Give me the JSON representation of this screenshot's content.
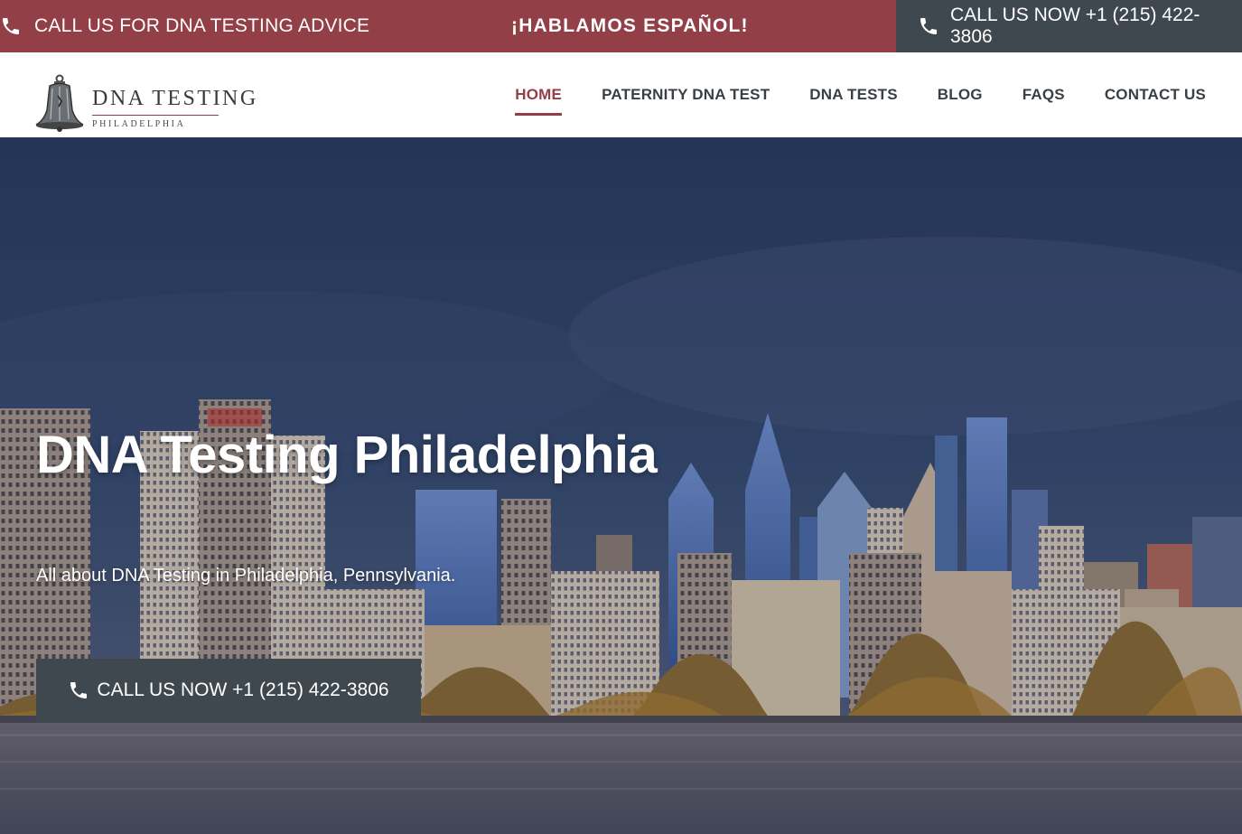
{
  "topbar": {
    "advice_label": "CALL US FOR DNA TESTING ADVICE",
    "spanish_label": "¡HABLAMOS ESPAÑOL!",
    "call_label": "CALL US NOW +1 (215) 422-3806"
  },
  "header": {
    "logo_title": "DNA TESTING",
    "logo_subtitle": "PHILADELPHIA",
    "nav": [
      {
        "label": "HOME",
        "active": true
      },
      {
        "label": "PATERNITY DNA TEST"
      },
      {
        "label": "DNA TESTS"
      },
      {
        "label": "BLOG"
      },
      {
        "label": "FAQS"
      },
      {
        "label": "CONTACT US"
      }
    ]
  },
  "hero": {
    "title": "DNA Testing Philadelphia",
    "subtitle": "All about DNA Testing in Philadelphia, Pennsylvania.",
    "cta_label": "CALL US NOW +1 (215) 422-3806"
  },
  "colors": {
    "brand_red": "#923f48",
    "dark_slate": "#3f474f",
    "nav_text": "#3a3f44"
  },
  "icons": [
    "phone-icon",
    "liberty-bell-icon"
  ]
}
